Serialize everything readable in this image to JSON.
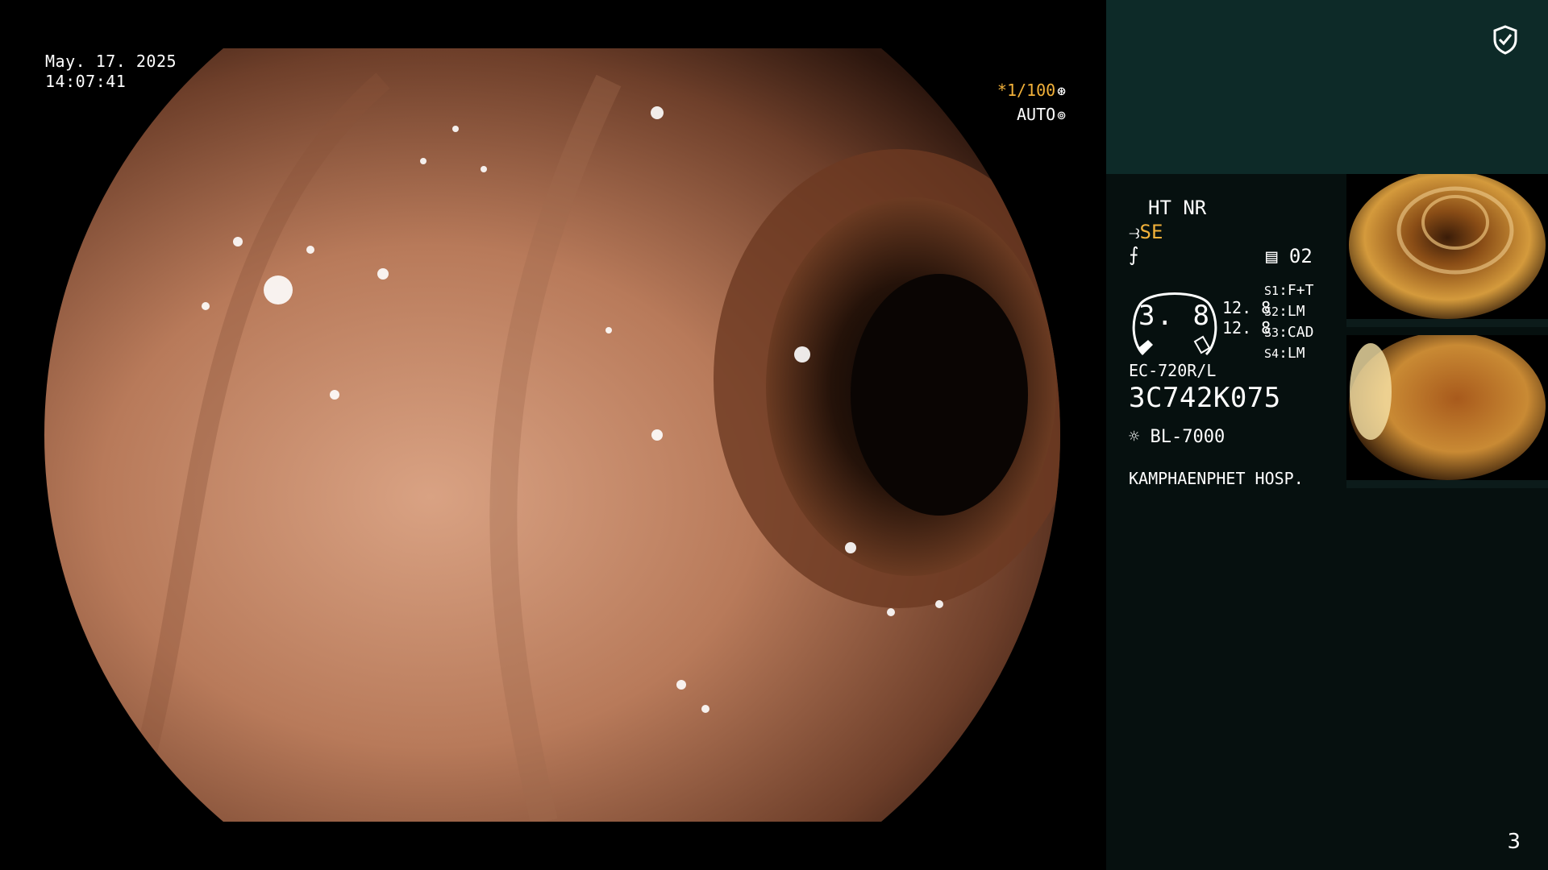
{
  "overlay": {
    "date": "May. 17. 2025",
    "time": "14:07:41",
    "shutter_speed": "*1/100",
    "exposure_mode": "AUTO"
  },
  "panel": {
    "mode": "HT NR",
    "enhance": "SE",
    "memory_label": "02",
    "gauge_value": "3. 8",
    "gauge_side_values": [
      "12. 8",
      "12. 8"
    ],
    "switches": [
      {
        "key": "S1",
        "value": "F+T"
      },
      {
        "key": "S2",
        "value": "LM"
      },
      {
        "key": "S3",
        "value": "CAD"
      },
      {
        "key": "S4",
        "value": "LM"
      }
    ],
    "scope_model": "EC-720R/L",
    "scope_serial": "3C742K075",
    "light_source": "BL-7000",
    "hospital": "KAMPHAENPHET HOSP.",
    "page_number": "3"
  },
  "icons": {
    "shield": "shield-check-icon",
    "scissors": "scope-tip-icon",
    "lightsource": "lamp-icon"
  },
  "colors": {
    "accent": "#f2b13a",
    "panel_bg": "#06100f",
    "panel_top_bg": "#0d2a28"
  }
}
